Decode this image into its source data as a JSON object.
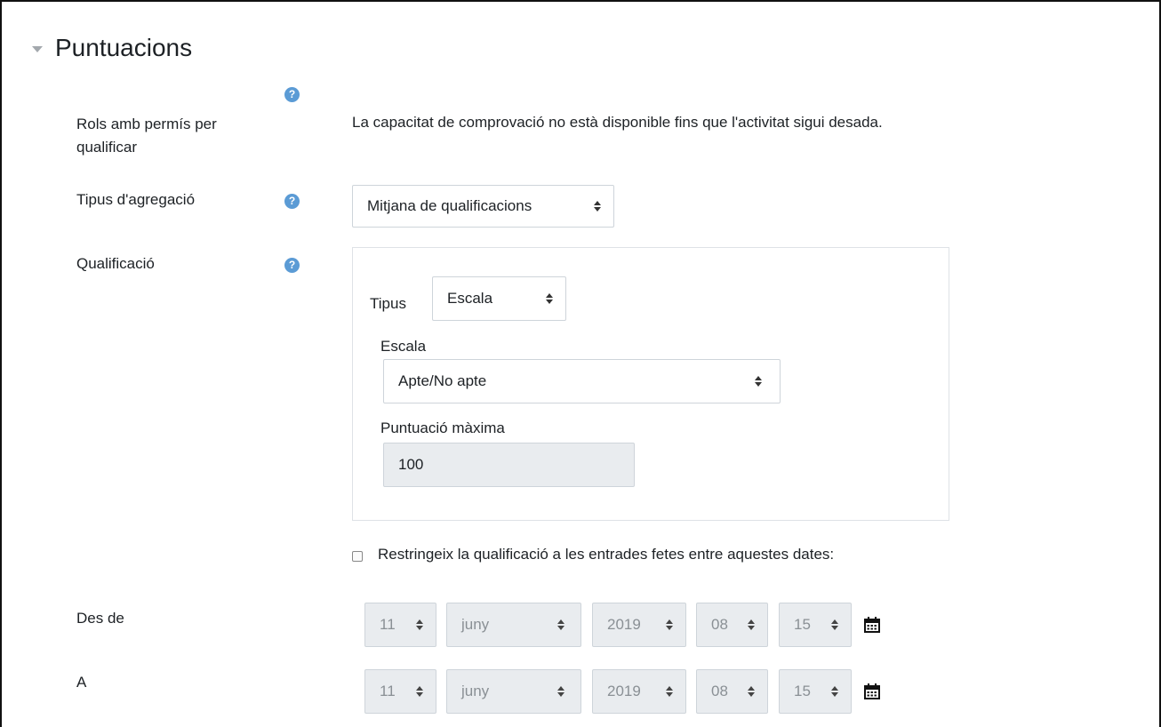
{
  "section": {
    "title": "Puntuacions"
  },
  "rows": {
    "roles": {
      "label_line1": "Rols amb permís per",
      "label_line2": "qualificar",
      "text": "La capacitat de comprovació no està disponible fins que l'activitat sigui desada."
    },
    "aggregation": {
      "label": "Tipus d'agregació",
      "value": "Mitjana de qualificacions"
    },
    "grade": {
      "label": "Qualificació",
      "type_label": "Tipus",
      "type_value": "Escala",
      "scale_label": "Escala",
      "scale_value": "Apte/No apte",
      "max_label": "Puntuació màxima",
      "max_value": "100"
    },
    "restrict": {
      "label": "Restringeix la qualificació a les entrades fetes entre aquestes dates:"
    },
    "from": {
      "label": "Des de",
      "day": "11",
      "month": "juny",
      "year": "2019",
      "hour": "08",
      "minute": "15"
    },
    "to": {
      "label": "A",
      "day": "11",
      "month": "juny",
      "year": "2019",
      "hour": "08",
      "minute": "15"
    }
  },
  "help_icon": "question-circle-icon",
  "calendar_icon": "calendar-icon",
  "colors": {
    "help": "#5b9bd5",
    "border": "#ced4da",
    "disabled_bg": "#e9ecef"
  }
}
